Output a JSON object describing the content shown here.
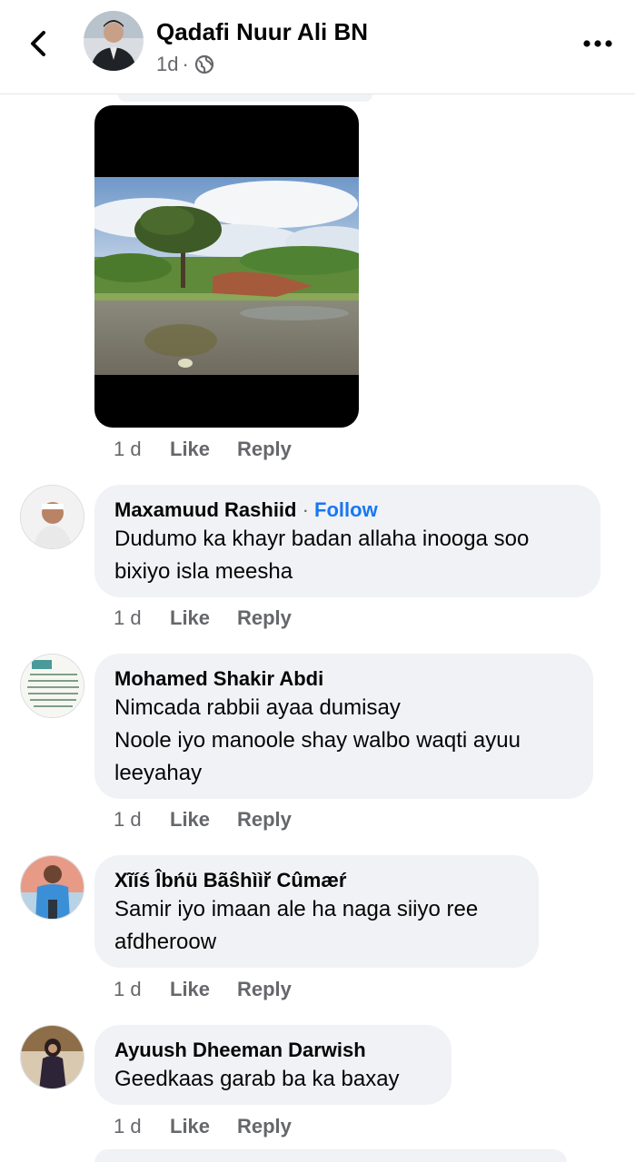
{
  "header": {
    "title": "Qadafi Nuur Ali BN",
    "meta_time": "1d",
    "meta_sep": "·"
  },
  "photo_actions": {
    "time": "1 d",
    "like": "Like",
    "reply": "Reply"
  },
  "comments": [
    {
      "name": "Maxamuud Rashiid",
      "sep": " · ",
      "follow": "Follow",
      "lines": [
        "Dudumo ka khayr badan allaha inooga soo",
        "bixiyo isla meesha"
      ],
      "time": "1 d",
      "like": "Like",
      "reply": "Reply"
    },
    {
      "name": "Mohamed Shakir Abdi",
      "lines": [
        "Nimcada rabbii ayaa dumisay",
        "Noole iyo manoole shay walbo waqti ayuu",
        "leeyahay"
      ],
      "time": "1 d",
      "like": "Like",
      "reply": "Reply"
    },
    {
      "name": "Xĩíś Îbńü Bãŝhììř Cûmæŕ",
      "lines": [
        "Samir iyo imaan ale ha naga siiyo ree",
        "afdheroow"
      ],
      "time": "1 d",
      "like": "Like",
      "reply": "Reply"
    },
    {
      "name": "Ayuush Dheeman Darwish",
      "lines": [
        "Geedkaas garab ba ka baxay"
      ],
      "time": "1 d",
      "like": "Like",
      "reply": "Reply"
    }
  ],
  "icons": {
    "back": "back-arrow-icon",
    "privacy": "globe-icon",
    "menu": "more-options-icon"
  },
  "colors": {
    "link": "#1877f2",
    "bubble": "#f0f2f5",
    "muted": "#65676b"
  }
}
